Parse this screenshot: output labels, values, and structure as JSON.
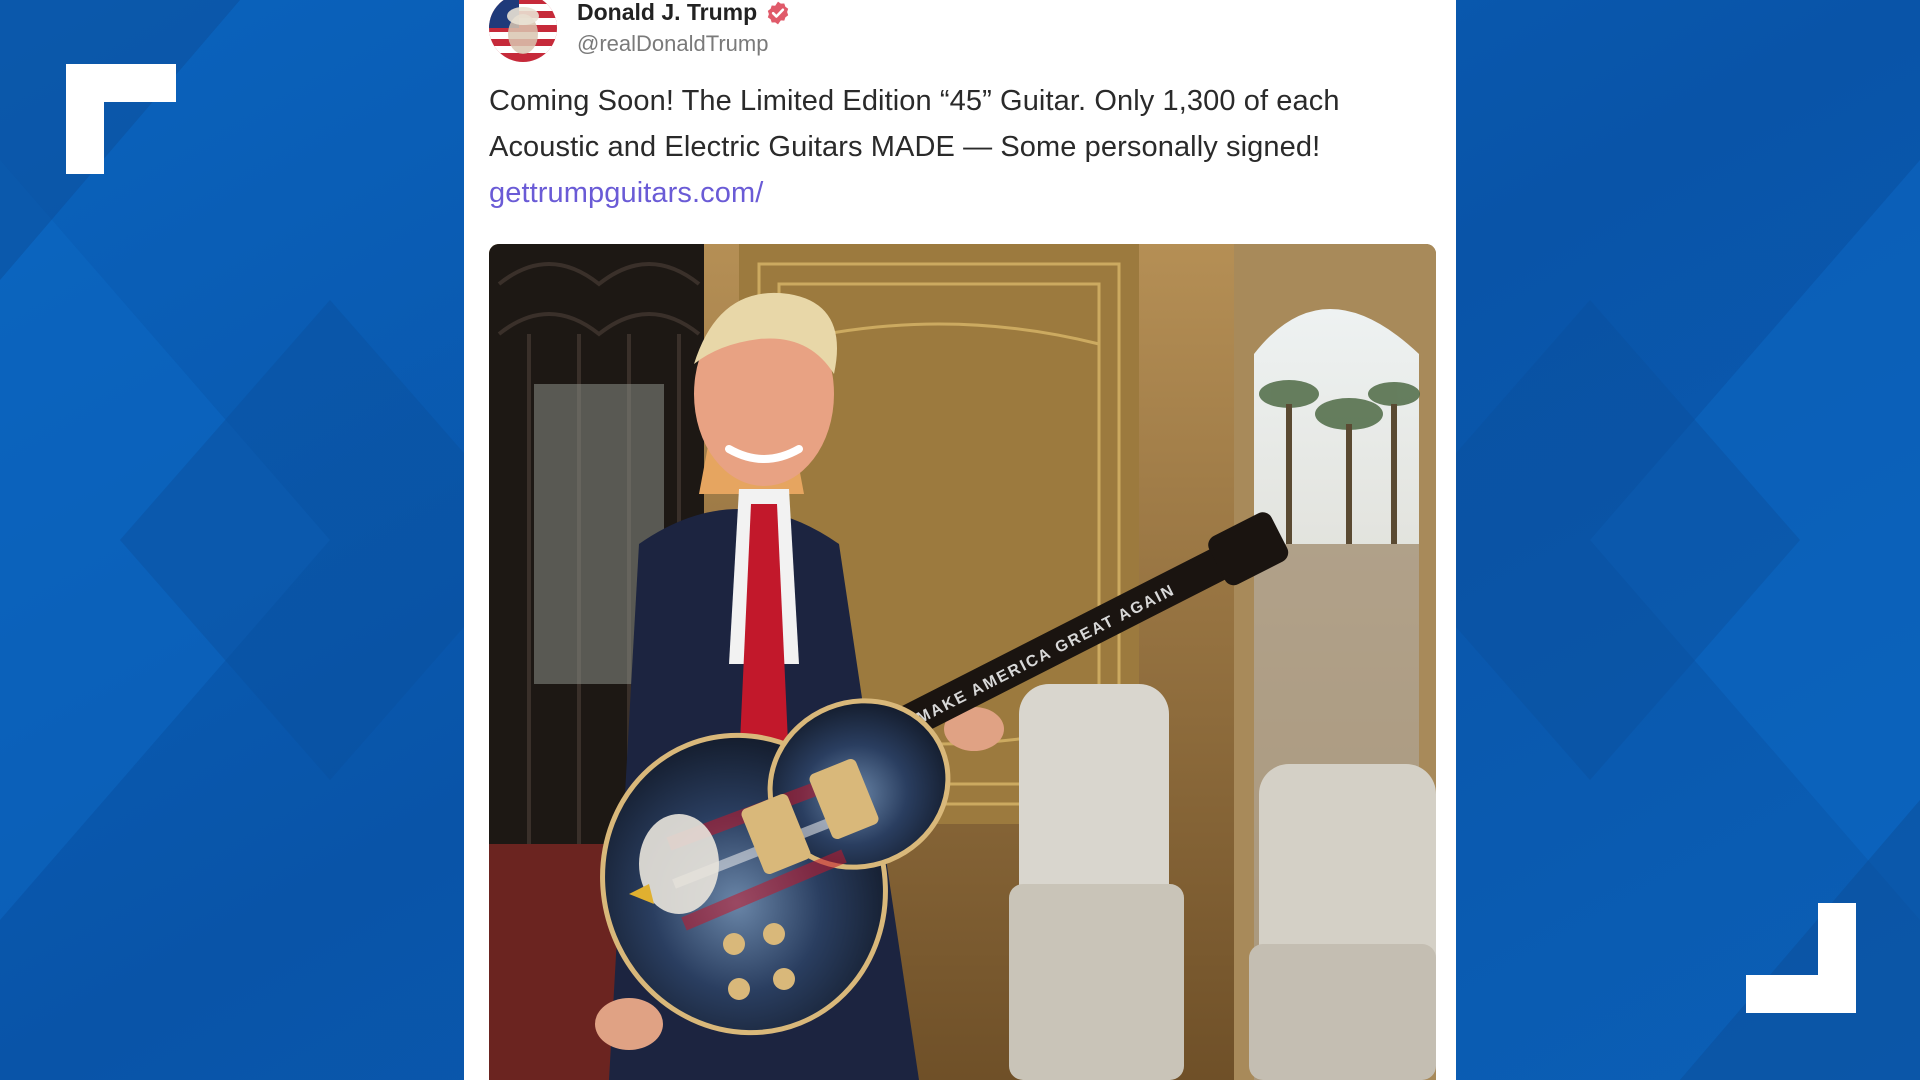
{
  "post": {
    "author_name": "Donald J. Trump",
    "author_handle": "@realDonaldTrump",
    "verified_icon": "verified-badge-icon",
    "text_line_1": "Coming Soon! The Limited Edition “45” Guitar. Only 1,300 of each",
    "text_line_2": "Acoustic and Electric Guitars MADE — Some personally signed!",
    "link": "gettrumpguitars.com/",
    "image_caption_on_guitar": "MAKE AMERICA GREAT AGAIN"
  },
  "colors": {
    "background_blue": "#0a5bb0",
    "link": "#6a5bd6",
    "verified_badge": "#e05a6a",
    "card": "#ffffff"
  }
}
